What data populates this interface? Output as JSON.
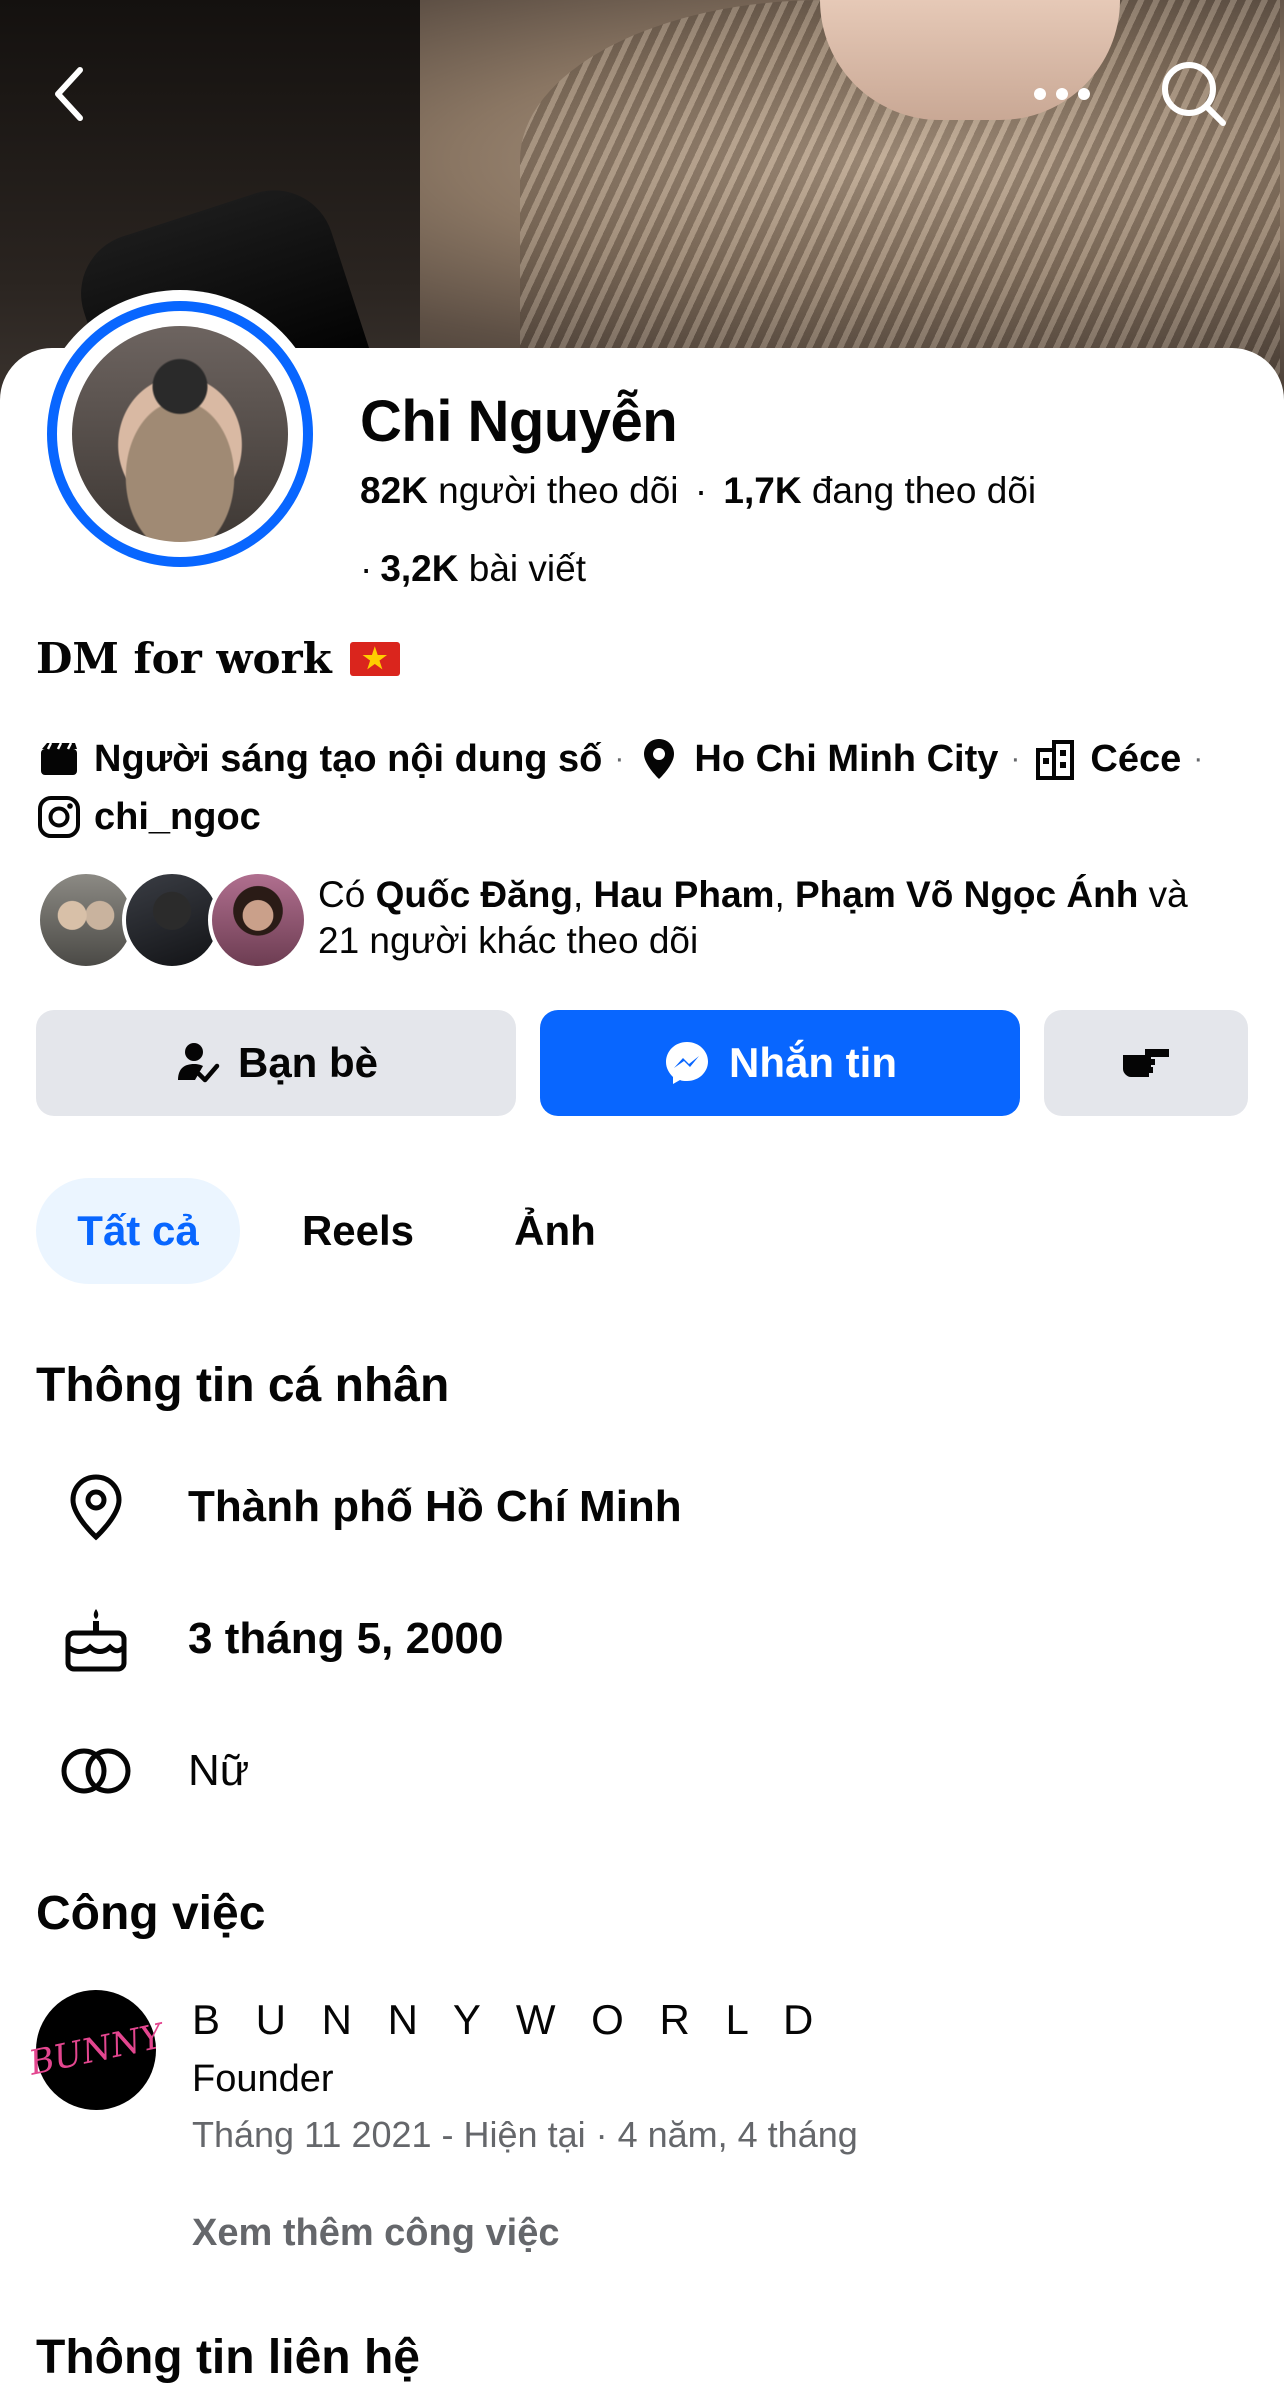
{
  "header": {
    "back_icon": "chevron-left-icon",
    "more_icon": "more-horizontal-icon",
    "search_icon": "search-icon"
  },
  "profile": {
    "name": "Chi Nguyễn",
    "followers_count": "82K",
    "followers_label": "người theo dõi",
    "following_count": "1,7K",
    "following_label": "đang theo dõi",
    "posts_count": "3,2K",
    "posts_label": "bài viết",
    "bio": "DM for work",
    "verified_ring_color": "#0866ff"
  },
  "meta": {
    "category": "Người sáng tạo nội dung số",
    "location": "Ho Chi Minh City",
    "workplace": "Céce",
    "instagram": "chi_ngoc"
  },
  "mutuals": {
    "prefix": "Có",
    "names": [
      "Quốc Đăng",
      "Hau Pham",
      "Phạm Võ Ngọc Ánh"
    ],
    "sep": ",",
    "and": "và",
    "suffix": "21 người khác theo dõi"
  },
  "actions": {
    "friends_label": "Bạn bè",
    "message_label": "Nhắn tin",
    "accent": "#0866ff"
  },
  "tabs": [
    {
      "label": "Tất cả",
      "active": true
    },
    {
      "label": "Reels",
      "active": false
    },
    {
      "label": "Ảnh",
      "active": false
    }
  ],
  "personal_info": {
    "title": "Thông tin cá nhân",
    "city": "Thành phố Hồ Chí Minh",
    "birthday": "3 tháng 5, 2000",
    "gender": "Nữ"
  },
  "work": {
    "title": "Công việc",
    "company": "B U N N Y W O R L D",
    "logo_text": "BUNNY",
    "role": "Founder",
    "period": "Tháng 11 2021 - Hiện tại · 4 năm, 4 tháng",
    "see_more": "Xem thêm công việc"
  },
  "contact": {
    "title": "Thông tin liên hệ"
  }
}
